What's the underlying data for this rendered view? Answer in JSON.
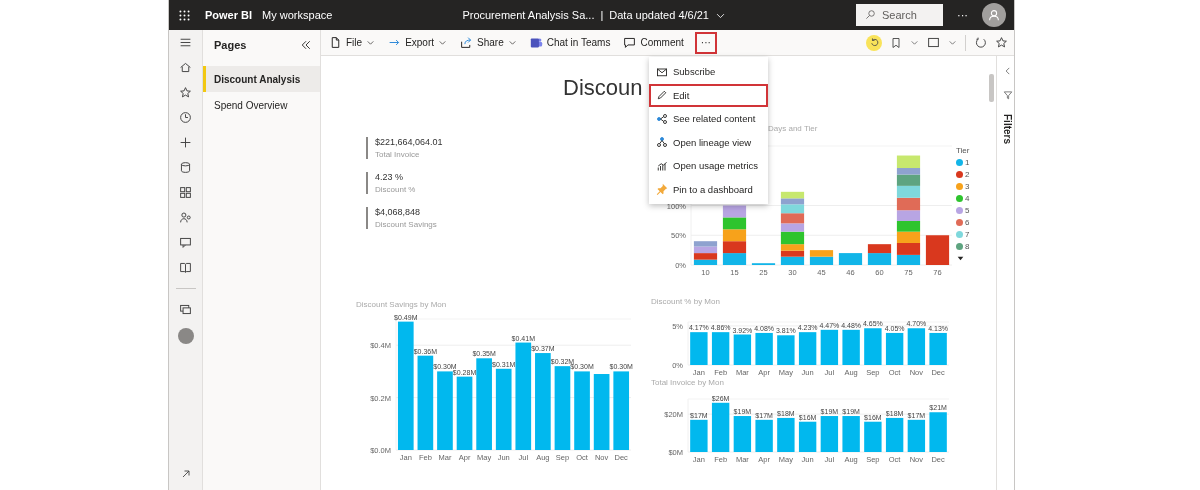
{
  "top_bar": {
    "app_name": "Power BI",
    "workspace": "My workspace",
    "report_title": "Procurement Analysis Sa...",
    "separator": "|",
    "data_updated": "Data updated 4/6/21",
    "search": {
      "placeholder": "Search"
    },
    "more": "···"
  },
  "pages": {
    "title": "Pages",
    "items": [
      {
        "label": "Discount Analysis",
        "selected": true
      },
      {
        "label": "Spend Overview",
        "selected": false
      }
    ]
  },
  "toolbar": {
    "items": [
      {
        "label": "File",
        "kind": "dropdown",
        "highlighted": false
      },
      {
        "label": "Export",
        "kind": "dropdown",
        "highlighted": false
      },
      {
        "label": "Share",
        "kind": "dropdown",
        "highlighted": false
      },
      {
        "label": "Chat in Teams",
        "kind": "button",
        "highlighted": false
      },
      {
        "label": "Comment",
        "kind": "button",
        "highlighted": false
      },
      {
        "label": "···",
        "kind": "more",
        "highlighted": true
      }
    ]
  },
  "menu": {
    "items": [
      {
        "label": "Subscribe",
        "highlighted": false
      },
      {
        "label": "Edit",
        "highlighted": true
      },
      {
        "label": "See related content",
        "highlighted": false
      },
      {
        "label": "Open lineage view",
        "highlighted": false
      },
      {
        "label": "Open usage metrics",
        "highlighted": false
      },
      {
        "label": "Pin to a dashboard",
        "highlighted": false
      }
    ]
  },
  "report": {
    "title": "Discoun",
    "kpis": [
      {
        "value": "$221,664,064.01",
        "label": "Total Invoice"
      },
      {
        "value": "4.23 %",
        "label": "Discount %"
      },
      {
        "value": "$4,068,848",
        "label": "Discount Savings"
      }
    ],
    "charts": [
      {
        "legend_title": "Tier",
        "chart_data": {
          "type": "bar",
          "title": "Days and Tier",
          "stacked": true,
          "categories": [
            "10",
            "15",
            "25",
            "30",
            "45",
            "46",
            "60",
            "75",
            "76"
          ],
          "ylim": [
            0,
            2
          ],
          "yticks": [
            {
              "value": 0,
              "label": "0%"
            },
            {
              "value": 0.5,
              "label": "50%"
            },
            {
              "value": 1,
              "label": "100%"
            }
          ],
          "series": [
            {
              "name": "1",
              "color": "#12b5e8",
              "values": [
                0.09,
                0.2,
                0.03,
                0.14,
                0.14,
                0.2,
                0.2,
                0.17,
                null
              ]
            },
            {
              "name": "2",
              "color": "#d9381e",
              "values": [
                0.11,
                0.2,
                null,
                0.1,
                null,
                null,
                0.15,
                0.2,
                0.5
              ]
            },
            {
              "name": "3",
              "color": "#f7a21b",
              "values": [
                null,
                0.2,
                null,
                0.11,
                0.11,
                null,
                null,
                0.19,
                null
              ]
            },
            {
              "name": "4",
              "color": "#2ec42e",
              "values": [
                null,
                0.2,
                null,
                0.21,
                null,
                null,
                null,
                0.18,
                null
              ]
            },
            {
              "name": "5",
              "color": "#b8a5e3",
              "values": [
                0.11,
                0.2,
                null,
                0.14,
                null,
                null,
                null,
                0.18,
                null
              ]
            },
            {
              "name": "6",
              "color": "#e06b57",
              "values": [
                null,
                null,
                null,
                0.17,
                null,
                null,
                null,
                0.21,
                null
              ]
            },
            {
              "name": "7",
              "color": "#7fd8dc",
              "values": [
                null,
                null,
                null,
                0.15,
                null,
                null,
                null,
                0.2,
                null
              ]
            },
            {
              "name": "8",
              "color": "#5ea480",
              "values": [
                null,
                null,
                null,
                null,
                null,
                null,
                null,
                0.19,
                null
              ]
            },
            {
              "color": "#8ea2cf",
              "values": [
                0.09,
                null,
                null,
                0.1,
                null,
                null,
                null,
                0.11,
                null
              ]
            },
            {
              "color": "#c7e86e",
              "values": [
                null,
                null,
                null,
                0.11,
                null,
                null,
                null,
                0.21,
                null
              ]
            }
          ]
        }
      },
      {
        "chart_data": {
          "type": "bar",
          "title": "Discount Savings by Mon",
          "categories": [
            "Jan",
            "Feb",
            "Mar",
            "Apr",
            "May",
            "Jun",
            "Jul",
            "Aug",
            "Sep",
            "Oct",
            "Nov",
            "Dec"
          ],
          "ylim": [
            0,
            0.5
          ],
          "yticks": [
            {
              "value": 0,
              "label": "$0.0M"
            },
            {
              "value": 0.2,
              "label": "$0.2M"
            },
            {
              "value": 0.4,
              "label": "$0.4M"
            }
          ],
          "value_labels": [
            "$0.49M",
            "$0.36M",
            "$0.30M",
            "$0.28M",
            "$0.35M",
            "$0.31M",
            "$0.41M",
            "$0.37M",
            "$0.32M",
            "$0.30M",
            null,
            "$0.30M"
          ],
          "series": [
            {
              "color": "#01b8ee",
              "values": [
                0.49,
                0.36,
                0.3,
                0.28,
                0.35,
                0.31,
                0.41,
                0.37,
                0.32,
                0.3,
                0.29,
                0.3
              ]
            }
          ]
        }
      },
      {
        "chart_data": {
          "type": "bar",
          "title": "Discount % by Mon",
          "categories": [
            "Jan",
            "Feb",
            "Mar",
            "Apr",
            "May",
            "Jun",
            "Jul",
            "Aug",
            "Sep",
            "Oct",
            "Nov",
            "Dec"
          ],
          "ylim": [
            0,
            5.5
          ],
          "yticks": [
            {
              "value": 0,
              "label": "0%"
            },
            {
              "value": 5,
              "label": "5%"
            }
          ],
          "value_labels": [
            "4.17%",
            "4.86%",
            "3.92%",
            "4.08%",
            "3.81%",
            "4.23%",
            "4.47%",
            "4.48%",
            "4.65%",
            "4.05%",
            "4.70%",
            "4.13%"
          ],
          "series": [
            {
              "color": "#01b8ee",
              "values": [
                4.2,
                4.2,
                3.9,
                4.1,
                3.8,
                4.2,
                4.5,
                4.5,
                4.7,
                4.1,
                4.7,
                4.1
              ]
            }
          ]
        }
      },
      {
        "chart_data": {
          "type": "bar",
          "title": "Total Invoice by Mon",
          "categories": [
            "Jan",
            "Feb",
            "Mar",
            "Apr",
            "May",
            "Jun",
            "Jul",
            "Aug",
            "Sep",
            "Oct",
            "Nov",
            "Dec"
          ],
          "ylim": [
            0,
            28
          ],
          "yticks": [
            {
              "value": 0,
              "label": "$0M"
            },
            {
              "value": 20,
              "label": "$20M"
            }
          ],
          "value_labels": [
            "$17M",
            "$26M",
            "$19M",
            "$17M",
            "$18M",
            "$16M",
            "$19M",
            "$19M",
            "$16M",
            "$18M",
            "$17M",
            "$21M"
          ],
          "series": [
            {
              "color": "#01b8ee",
              "values": [
                17,
                26,
                19,
                17,
                18,
                16,
                19,
                19,
                16,
                18,
                17,
                21
              ]
            }
          ]
        }
      }
    ]
  },
  "filters_pane": {
    "label": "Filters"
  }
}
